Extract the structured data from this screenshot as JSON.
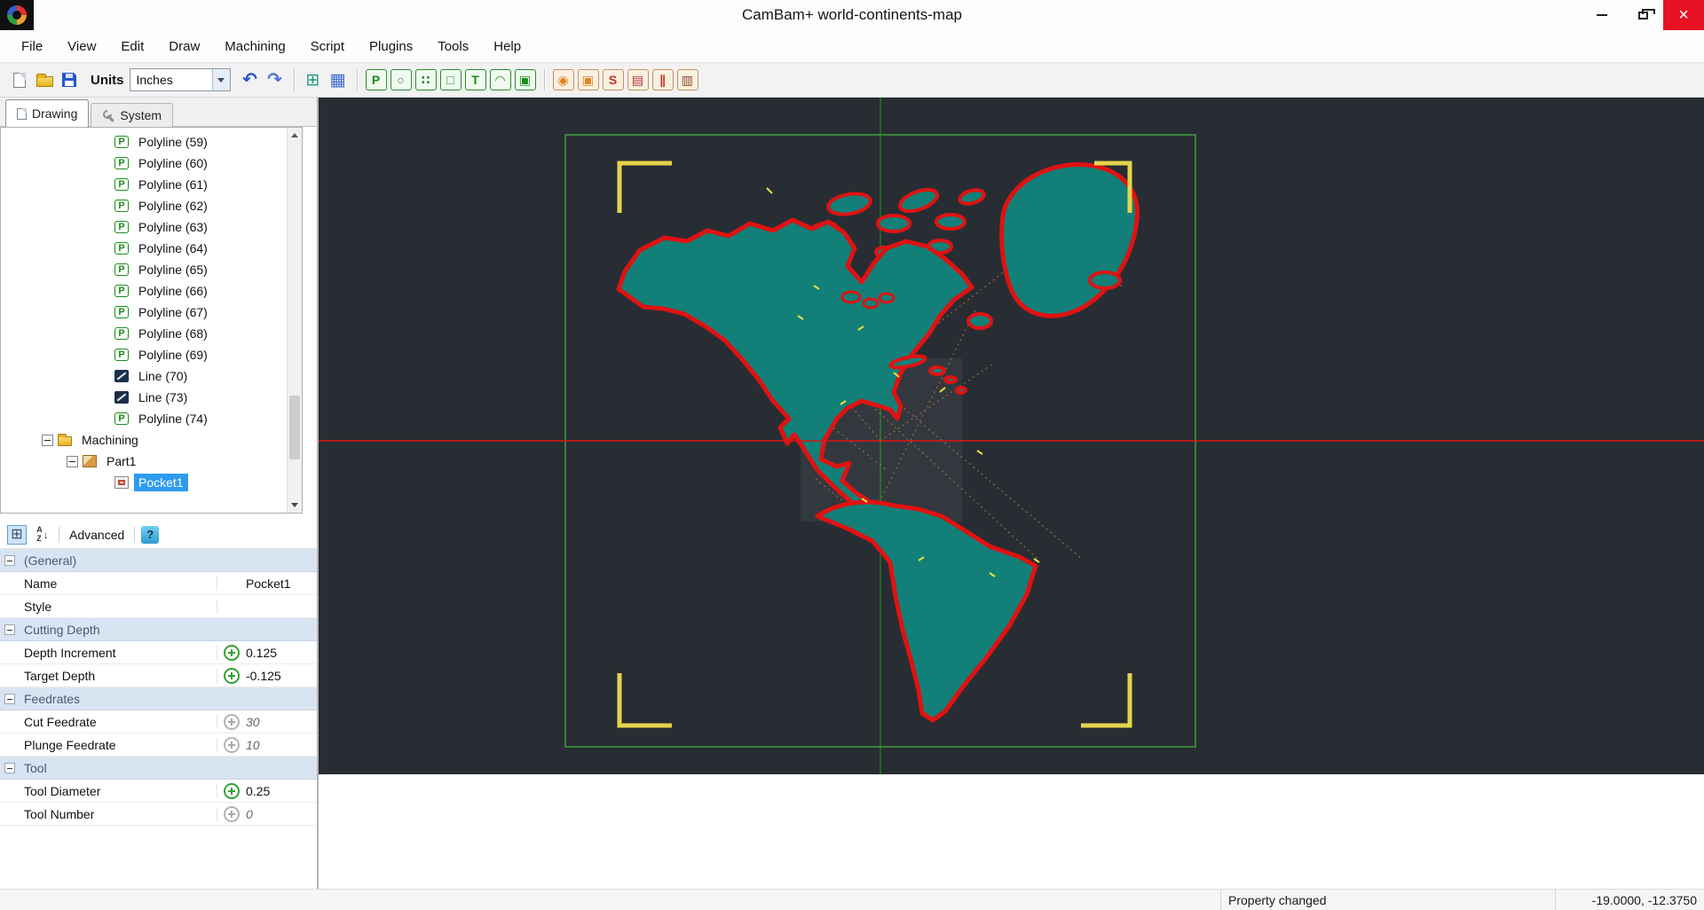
{
  "window": {
    "title": "CamBam+  world-continents-map",
    "close_glyph": "×"
  },
  "menubar": [
    "File",
    "View",
    "Edit",
    "Draw",
    "Machining",
    "Script",
    "Plugins",
    "Tools",
    "Help"
  ],
  "toolbar": {
    "units_label": "Units",
    "units_value": "Inches",
    "draw_tools": [
      {
        "name": "draw-polyline-icon",
        "glyph": "P"
      },
      {
        "name": "draw-circle-icon",
        "glyph": "○"
      },
      {
        "name": "draw-points-icon",
        "glyph": "∷"
      },
      {
        "name": "draw-rect-icon",
        "glyph": "□"
      },
      {
        "name": "draw-text-icon",
        "glyph": "T"
      },
      {
        "name": "draw-arc-icon",
        "glyph": "◠"
      },
      {
        "name": "draw-solid-icon",
        "glyph": "▣"
      }
    ],
    "machine_ops": [
      {
        "name": "mop-drill-icon",
        "glyph": "◉"
      },
      {
        "name": "mop-pocket-icon",
        "glyph": "▣"
      },
      {
        "name": "mop-profile-icon",
        "glyph": "S"
      },
      {
        "name": "mop-engrave-icon",
        "glyph": "▤"
      },
      {
        "name": "mop-3dprofile-icon",
        "glyph": "∥"
      },
      {
        "name": "mop-lathe-icon",
        "glyph": "▥"
      }
    ]
  },
  "icons": {
    "undo": "↶",
    "redo": "↷",
    "snap_grid": "⊞",
    "grid": "▦",
    "categorized": "⊞",
    "sort_a": "A",
    "sort_z": "Z",
    "sort_arrow": "↓",
    "help": "?"
  },
  "sidebar": {
    "tabs": [
      {
        "label": "Drawing",
        "icon": "page",
        "active": true
      },
      {
        "label": "System",
        "icon": "wrench",
        "active": false
      }
    ],
    "tree": [
      {
        "label": "Polyline (59)",
        "icon": "polyline",
        "level": 3
      },
      {
        "label": "Polyline (60)",
        "icon": "polyline",
        "level": 3
      },
      {
        "label": "Polyline (61)",
        "icon": "polyline",
        "level": 3
      },
      {
        "label": "Polyline (62)",
        "icon": "polyline",
        "level": 3
      },
      {
        "label": "Polyline (63)",
        "icon": "polyline",
        "level": 3
      },
      {
        "label": "Polyline (64)",
        "icon": "polyline",
        "level": 3
      },
      {
        "label": "Polyline (65)",
        "icon": "polyline",
        "level": 3
      },
      {
        "label": "Polyline (66)",
        "icon": "polyline",
        "level": 3
      },
      {
        "label": "Polyline (67)",
        "icon": "polyline",
        "level": 3
      },
      {
        "label": "Polyline (68)",
        "icon": "polyline",
        "level": 3
      },
      {
        "label": "Polyline (69)",
        "icon": "polyline",
        "level": 3
      },
      {
        "label": "Line (70)",
        "icon": "line",
        "level": 3
      },
      {
        "label": "Line (73)",
        "icon": "line",
        "level": 3
      },
      {
        "label": "Polyline (74)",
        "icon": "polyline",
        "level": 3
      },
      {
        "label": "Machining",
        "icon": "folder",
        "level": 1,
        "expander": true
      },
      {
        "label": "Part1",
        "icon": "part",
        "level": 2,
        "expander": true
      },
      {
        "label": "Pocket1",
        "icon": "pocket",
        "level": 3,
        "selected": true
      }
    ]
  },
  "properties": {
    "toolbar": {
      "advanced": "Advanced"
    },
    "rows": [
      {
        "type": "section",
        "label": "(General)",
        "value": ""
      },
      {
        "type": "row",
        "label": "Name",
        "value": "Pocket1"
      },
      {
        "type": "row",
        "label": "Style",
        "value": ""
      },
      {
        "type": "section",
        "label": "Cutting Depth",
        "value": ""
      },
      {
        "type": "row",
        "label": "Depth Increment",
        "value": "0.125",
        "icon": "set"
      },
      {
        "type": "row",
        "label": "Target Depth",
        "value": "-0.125",
        "icon": "set"
      },
      {
        "type": "section",
        "label": "Feedrates",
        "value": ""
      },
      {
        "type": "row",
        "label": "Cut Feedrate",
        "value": "30",
        "icon": "default",
        "italic": true
      },
      {
        "type": "row",
        "label": "Plunge Feedrate",
        "value": "10",
        "icon": "default",
        "italic": true
      },
      {
        "type": "section",
        "label": "Tool",
        "value": ""
      },
      {
        "type": "row",
        "label": "Tool Diameter",
        "value": "0.25",
        "icon": "set"
      },
      {
        "type": "row",
        "label": "Tool Number",
        "value": "0",
        "icon": "default",
        "italic": true
      }
    ]
  },
  "statusbar": {
    "message": "Property changed",
    "coordinates": "-19.0000, -12.3750"
  },
  "colors": {
    "selection": "#2e9bef",
    "canvas_bg": "#282d33",
    "map_fill": "#128078",
    "map_stroke": "#e01212",
    "frame_green": "#3da03d",
    "bracket_yellow": "#e5d44a",
    "axis_red": "#dd1414",
    "axis_green": "#1c7a1c",
    "rapid_orange": "#c08030",
    "section_bg": "#d9e4f3",
    "close_red": "#e81123"
  }
}
